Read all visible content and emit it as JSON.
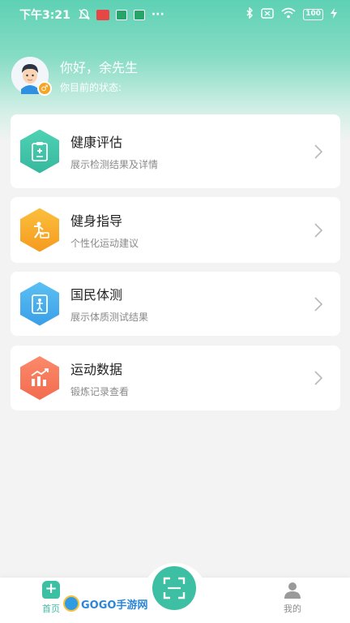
{
  "status_bar": {
    "time": "下午3:21",
    "battery": "100"
  },
  "profile": {
    "greeting": "你好，余先生",
    "status_label": "你目前的状态:"
  },
  "cards": [
    {
      "title": "健康评估",
      "subtitle": "展示检测结果及详情",
      "icon": "health-report-icon",
      "color_from": "#4fd1b4",
      "color_to": "#35b89c"
    },
    {
      "title": "健身指导",
      "subtitle": "个性化运动建议",
      "icon": "exercise-guide-icon",
      "color_from": "#fbbf3c",
      "color_to": "#f59a1f"
    },
    {
      "title": "国民体测",
      "subtitle": "展示体质测试结果",
      "icon": "body-test-icon",
      "color_from": "#5bc0f2",
      "color_to": "#3a9ee8"
    },
    {
      "title": "运动数据",
      "subtitle": "锻炼记录查看",
      "icon": "sport-data-icon",
      "color_from": "#fb8a6b",
      "color_to": "#f36b4e"
    }
  ],
  "tabs": {
    "home": "首页",
    "mine": "我的"
  },
  "watermark": "GOGO手游网",
  "colors": {
    "accent": "#3dbfa3"
  }
}
